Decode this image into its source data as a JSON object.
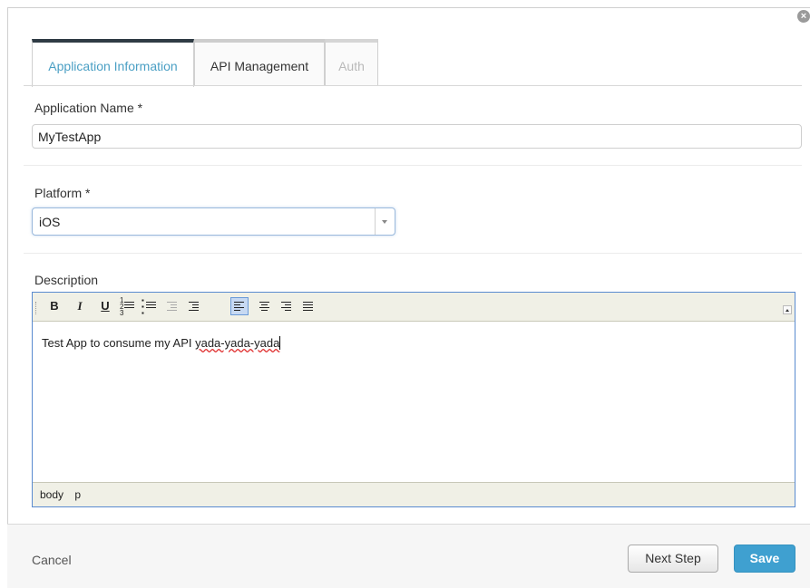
{
  "tabs": [
    {
      "label": "Application Information",
      "state": "active"
    },
    {
      "label": "API Management",
      "state": "inactive"
    },
    {
      "label": "Auth",
      "state": "disabled"
    }
  ],
  "form": {
    "app_name_label": "Application Name *",
    "app_name_value": "MyTestApp",
    "platform_label": "Platform *",
    "platform_value": "iOS",
    "description_label": "Description"
  },
  "editor": {
    "toolbar_icons": [
      "bold-icon",
      "italic-icon",
      "underline-icon",
      "numbered-list-icon",
      "bulleted-list-icon",
      "outdent-icon",
      "indent-icon",
      "align-left-icon",
      "align-center-icon",
      "align-right-icon",
      "justify-icon",
      "toolbar-expand-icon"
    ],
    "bold_glyph": "B",
    "italic_glyph": "I",
    "underline_glyph": "U",
    "content_prefix": "Test App to consume my API ",
    "content_misspelled": "yada-yada-yada",
    "status_path": [
      "body",
      "p"
    ]
  },
  "footer": {
    "cancel_label": "Cancel",
    "next_label": "Next Step",
    "save_label": "Save"
  },
  "colors": {
    "accent": "#4a9fc4",
    "save_button": "#3fa0d0",
    "active_tab_bar": "#2f3b44",
    "editor_border": "#5a8bd0",
    "toolbar_bg": "#f0f0e6"
  }
}
